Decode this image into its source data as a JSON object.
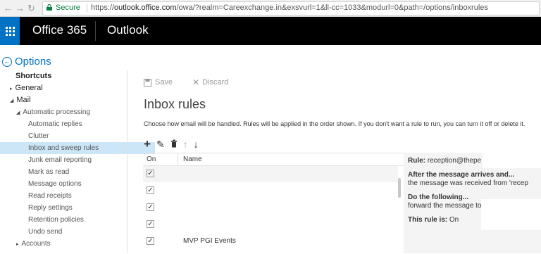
{
  "browser": {
    "secure_label": "Secure",
    "url_scheme": "https://",
    "url_host": "outlook.office.com",
    "url_rest": "/owa/?realm=Careexchange.in&exsvurl=1&ll-cc=1033&modurl=0&path=/options/inboxrules"
  },
  "suite": {
    "brand": "Office 365",
    "app": "Outlook"
  },
  "options_title": "Options",
  "nav": {
    "items": [
      {
        "label": "Shortcuts",
        "level": "l0"
      },
      {
        "label": "General",
        "level": "l0a",
        "caret": "▸"
      },
      {
        "label": "Mail",
        "level": "l0a",
        "caret": "◢"
      },
      {
        "label": "Automatic processing",
        "level": "l1",
        "caret": "◢"
      },
      {
        "label": "Automatic replies",
        "level": "l2"
      },
      {
        "label": "Clutter",
        "level": "l2"
      },
      {
        "label": "Inbox and sweep rules",
        "level": "l2",
        "selected": true
      },
      {
        "label": "Junk email reporting",
        "level": "l2"
      },
      {
        "label": "Mark as read",
        "level": "l2"
      },
      {
        "label": "Message options",
        "level": "l2"
      },
      {
        "label": "Read receipts",
        "level": "l2"
      },
      {
        "label": "Reply settings",
        "level": "l2"
      },
      {
        "label": "Retention policies",
        "level": "l2"
      },
      {
        "label": "Undo send",
        "level": "l2"
      },
      {
        "label": "Accounts",
        "level": "l1",
        "caret": "▸"
      }
    ]
  },
  "toolbar": {
    "save_label": "Save",
    "discard_label": "Discard"
  },
  "page_title": "Inbox rules",
  "description": "Choose how email will be handled. Rules will be applied in the order shown. If you don't want a rule to run, you can turn it off or delete it.",
  "grid": {
    "col_on": "On",
    "col_name": "Name",
    "rows": [
      {
        "on": true,
        "name": ""
      },
      {
        "on": true,
        "name": ""
      },
      {
        "on": true,
        "name": ""
      },
      {
        "on": true,
        "name": ""
      },
      {
        "on": true,
        "name": "MVP PGI Events"
      }
    ]
  },
  "detail": {
    "rule_label": "Rule:",
    "rule_value": "reception@thepe",
    "after_label": "After the message arrives and...",
    "after_value": "the message was received from 'recep",
    "do_label": "Do the following...",
    "do_value": "forward the message to",
    "status_label": "This rule is:",
    "status_value": "On"
  },
  "colors": {
    "accent": "#0072c6",
    "suitebar": "#000000",
    "selected_nav": "#cde6f7"
  }
}
